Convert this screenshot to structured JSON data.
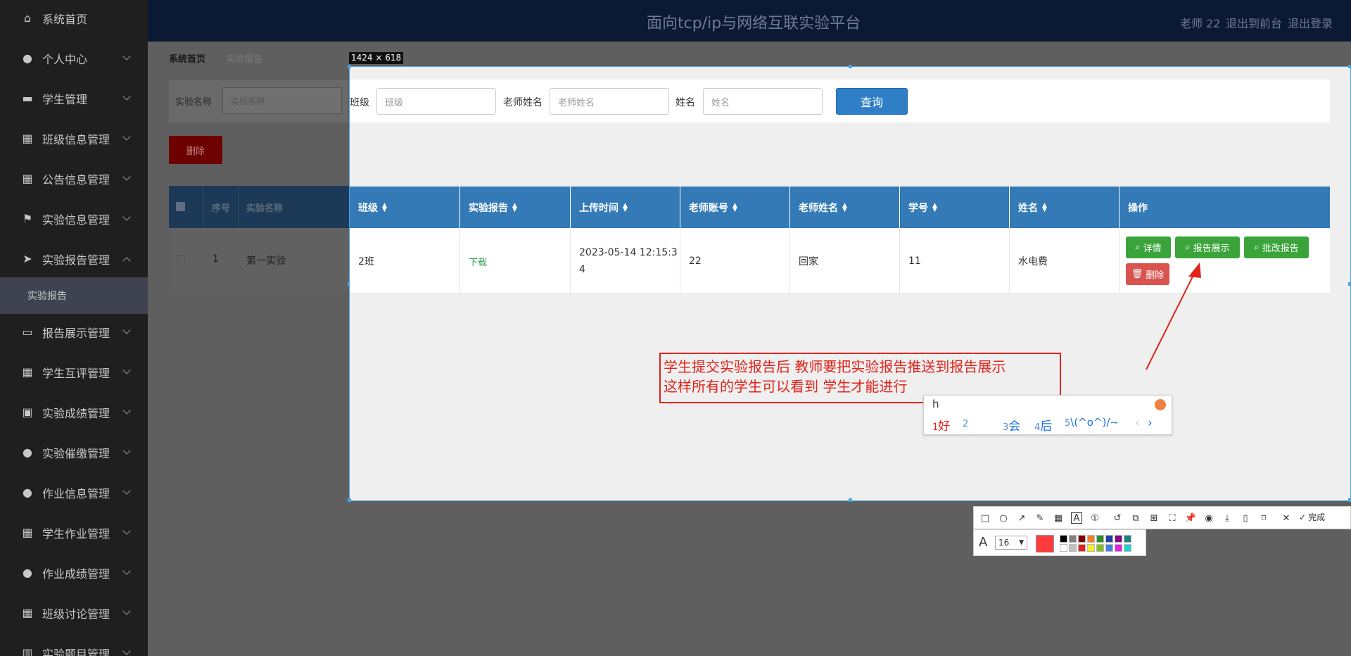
{
  "header": {
    "title": "面向tcp/ip与网络互联实验平台",
    "user": "老师 22",
    "front": "退出到前台",
    "logout": "退出登录"
  },
  "sidebar": {
    "items": [
      {
        "label": "系统首页",
        "icon": "home-icon"
      },
      {
        "label": "个人中心",
        "icon": "user-icon"
      },
      {
        "label": "学生管理",
        "icon": "student-icon"
      },
      {
        "label": "班级信息管理",
        "icon": "grid-icon"
      },
      {
        "label": "公告信息管理",
        "icon": "grid-icon"
      },
      {
        "label": "实验信息管理",
        "icon": "flag-icon"
      },
      {
        "label": "实验报告管理",
        "icon": "send-icon"
      },
      {
        "label": "报告展示管理",
        "icon": "ticket-icon"
      },
      {
        "label": "学生互评管理",
        "icon": "grid-icon"
      },
      {
        "label": "实验成绩管理",
        "icon": "briefcase-icon"
      },
      {
        "label": "实验催缴管理",
        "icon": "user-icon"
      },
      {
        "label": "作业信息管理",
        "icon": "user-icon"
      },
      {
        "label": "学生作业管理",
        "icon": "grid-icon"
      },
      {
        "label": "作业成绩管理",
        "icon": "bulb-icon"
      },
      {
        "label": "班级讨论管理",
        "icon": "grid-icon"
      },
      {
        "label": "实验题目管理",
        "icon": "chart-icon"
      }
    ],
    "sub_item": "实验报告"
  },
  "breadcrumb": {
    "home": "系统首页",
    "current": "实验报告"
  },
  "background_page": {
    "filter_label": "实验名称",
    "filter_placeholder": "实验名称",
    "delete_button": "删除",
    "columns": [
      "序号",
      "实验名称"
    ],
    "row": {
      "index": "1",
      "name": "第一实验"
    }
  },
  "screenshot_overlay": {
    "size_label": "1424 × 618",
    "query": {
      "class_label": "班级",
      "class_placeholder": "班级",
      "teacher_label": "老师姓名",
      "teacher_placeholder": "老师姓名",
      "name_label": "姓名",
      "name_placeholder": "姓名",
      "button": "查询"
    },
    "table": {
      "columns": [
        "班级",
        "实验报告",
        "上传时间",
        "老师账号",
        "老师姓名",
        "学号",
        "姓名",
        "操作"
      ],
      "rows": [
        {
          "class": "2班",
          "report": "下载",
          "upload_time_line1": "2023-05-14 12:15:3",
          "upload_time_line2": "4",
          "teacher_account": "22",
          "teacher_name": "回家",
          "student_no": "11",
          "student_name": "水电费",
          "actions": [
            "详情",
            "报告展示",
            "批改报告",
            "删除"
          ]
        }
      ]
    },
    "annotation": {
      "line1": "学生提交实验报告后 教师要把实验报告推送到报告展示",
      "line2": "这样所有的学生可以看到  学生才能进行"
    },
    "ime": {
      "input": "h",
      "candidates": [
        {
          "num": "1",
          "text": "好"
        },
        {
          "num": "2",
          "text": ""
        },
        {
          "num": "3",
          "text": "会"
        },
        {
          "num": "4",
          "text": "后"
        },
        {
          "num": "5",
          "text": "\\(^o^)/~"
        }
      ]
    },
    "toolbar": {
      "done": "完成",
      "font_size": "16",
      "active_color": "#ff3b3b",
      "palette": [
        "#000000",
        "#808080",
        "#800000",
        "#f08030",
        "#2e8b2e",
        "#1e40a0",
        "#800080",
        "#208080",
        "#ffffff",
        "#c0c0c0",
        "#e02020",
        "#f0f020",
        "#80c020",
        "#4080e0",
        "#e020e0",
        "#20d0d0"
      ]
    }
  }
}
